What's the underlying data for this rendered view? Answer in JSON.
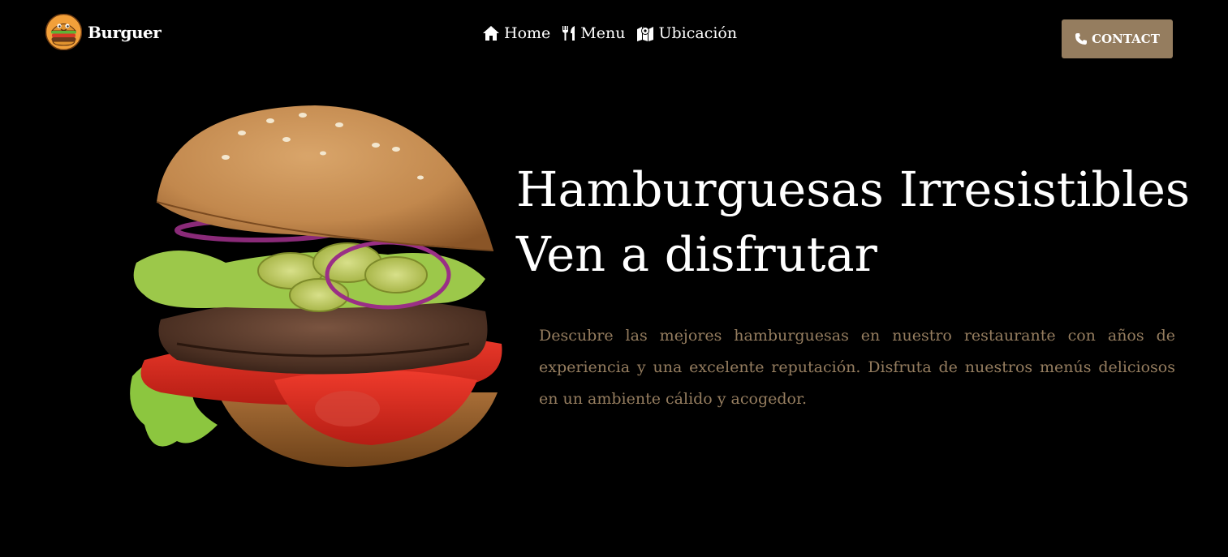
{
  "brand": {
    "name": "Burguer",
    "logo_icon": "burger-mascot-icon"
  },
  "nav": {
    "items": [
      {
        "label": "Home",
        "icon": "home-icon"
      },
      {
        "label": "Menu",
        "icon": "utensils-icon"
      },
      {
        "label": "Ubicación",
        "icon": "map-icon"
      }
    ]
  },
  "contact": {
    "label": "CONTACT",
    "icon": "phone-icon"
  },
  "hero": {
    "title_line1": "Hamburguesas Irresistibles",
    "title_line2": "Ven a disfrutar",
    "description": "Descubre las mejores hamburguesas en nuestro restaurante con años de experiencia y una excelente reputación. Disfruta de nuestros menús deliciosos en un ambiente cálido y acogedor.",
    "image": "burger-photo"
  },
  "colors": {
    "background": "#000000",
    "accent": "#957d5f",
    "text": "#ffffff"
  }
}
